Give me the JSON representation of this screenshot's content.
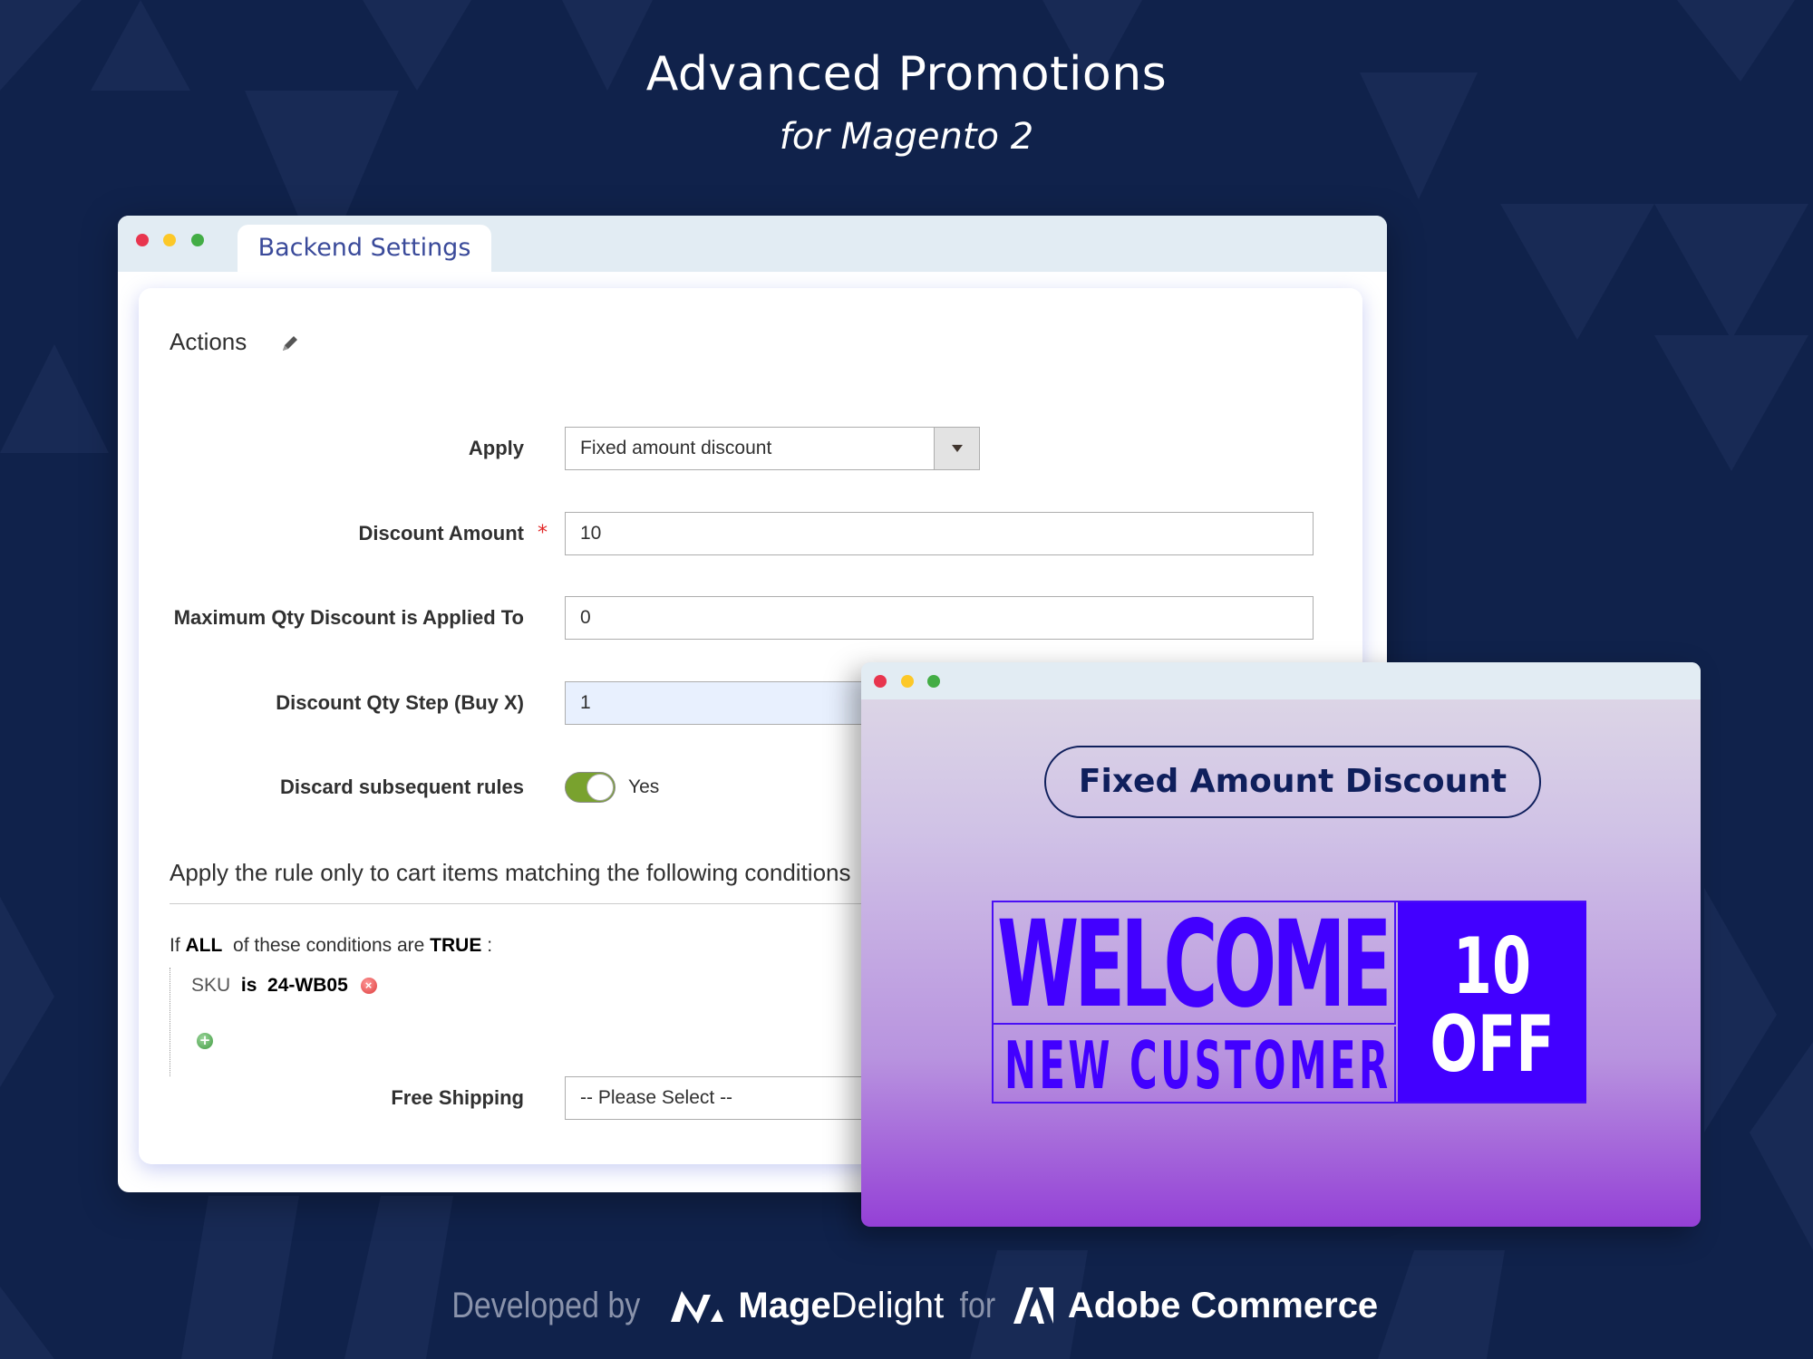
{
  "header": {
    "title": "Advanced Promotions",
    "subtitle": "for Magento 2"
  },
  "backend_window": {
    "tab_label": "Backend Settings",
    "section_title": "Actions",
    "fields": {
      "apply": {
        "label": "Apply",
        "value": "Fixed amount discount"
      },
      "discount_amount": {
        "label": "Discount Amount",
        "required_mark": "*",
        "value": "10"
      },
      "max_qty": {
        "label": "Maximum Qty Discount is Applied To",
        "value": "0"
      },
      "qty_step": {
        "label": "Discount Qty Step (Buy X)",
        "value": "1"
      },
      "discard_rules": {
        "label": "Discard subsequent rules",
        "value_text": "Yes",
        "enabled": true
      },
      "free_shipping": {
        "label": "Free Shipping",
        "value": "-- Please Select --"
      }
    },
    "conditions": {
      "heading": "Apply the rule only to cart items matching the following conditions",
      "intro_prefix": "If",
      "aggregator": "ALL",
      "intro_middle": "of these conditions are",
      "value": "TRUE",
      "intro_suffix": ":",
      "rows": [
        {
          "attribute": "SKU",
          "operator": "is",
          "value": "24-WB05"
        }
      ]
    }
  },
  "promo_window": {
    "pill_label": "Fixed Amount Discount",
    "banner": {
      "headline": "WELCOME",
      "subline": "NEW CUSTOMER",
      "amount": "10",
      "off_label": "OFF"
    }
  },
  "footer": {
    "developed_by": "Developed by",
    "brand_bold": "Mage",
    "brand_light": "Delight",
    "for_text": "for",
    "platform": "Adobe Commerce"
  },
  "colors": {
    "background": "#10224b",
    "tab_text": "#3a4a9a",
    "toggle_on": "#79a22e",
    "required": "#e22626",
    "banner_blue": "#4200ff",
    "pill_text": "#0f1f5c",
    "dot_red": "#e8354e",
    "dot_yellow": "#fcc828",
    "dot_green": "#43ad45"
  }
}
